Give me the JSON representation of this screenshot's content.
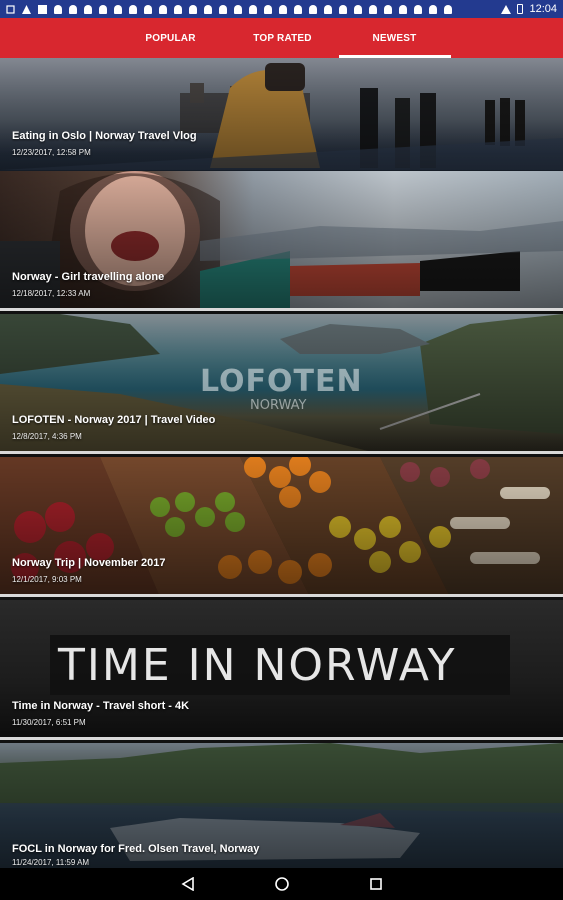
{
  "status_bar": {
    "time": "12:04"
  },
  "tabs": [
    {
      "label": "POPULAR",
      "active": false
    },
    {
      "label": "TOP RATED",
      "active": false
    },
    {
      "label": "NEWEST",
      "active": true
    }
  ],
  "videos": [
    {
      "title": "Eating in Oslo | Norway Travel Vlog",
      "date": "12/23/2017, 12:58 PM"
    },
    {
      "title": "Norway - Girl travelling alone",
      "date": "12/18/2017, 12:33 AM"
    },
    {
      "title": "LOFOTEN - Norway 2017 | Travel Video",
      "date": "12/8/2017, 4:36 PM",
      "thumb_title": "LOFOTEN",
      "thumb_subtitle": "NORWAY"
    },
    {
      "title": "Norway Trip | November 2017",
      "date": "12/1/2017, 9:03 PM"
    },
    {
      "title": "Time in Norway - Travel short - 4K",
      "date": "11/30/2017, 6:51 PM",
      "thumb_title": "TIME IN NORWAY"
    },
    {
      "title": "FOCL in Norway for Fred. Olsen Travel, Norway",
      "date": "11/24/2017, 11:59 AM"
    }
  ],
  "colors": {
    "status_bar": "#233a8f",
    "tab_bar": "#d8272f",
    "divider": "#d9d9d9"
  },
  "nav_icons": [
    "back-icon",
    "home-icon",
    "recents-icon"
  ]
}
